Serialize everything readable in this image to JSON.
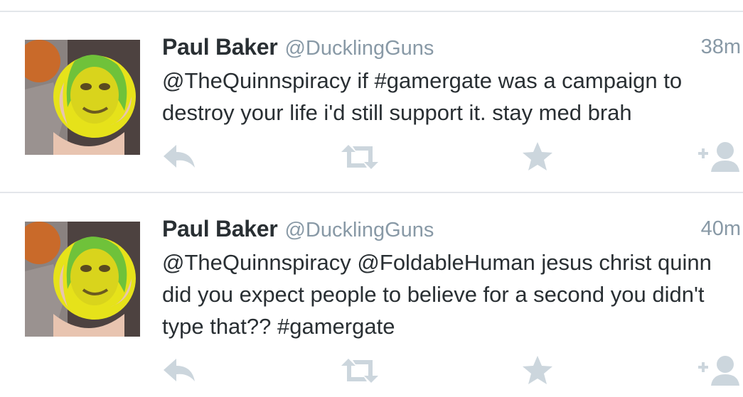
{
  "tweets": [
    {
      "author_name": "Paul Baker",
      "author_handle": "@DucklingGuns",
      "time": "38m",
      "text": "@TheQuinnspiracy if #gamergate was a campaign to destroy your life i'd still support it. stay med brah",
      "actions": [
        "reply-icon",
        "retweet-icon",
        "favorite-icon",
        "follow-icon"
      ]
    },
    {
      "author_name": "Paul Baker",
      "author_handle": "@DucklingGuns",
      "time": "40m",
      "text": "@TheQuinnspiracy @FoldableHuman jesus christ quinn did you expect people to believe for a second you didn't type that?? #gamergate",
      "actions": [
        "reply-icon",
        "retweet-icon",
        "favorite-icon",
        "follow-icon"
      ]
    }
  ],
  "colors": {
    "name": "#292f33",
    "meta": "#8899a6",
    "icon": "#ccd6dd",
    "divider": "#e3e6ea"
  }
}
